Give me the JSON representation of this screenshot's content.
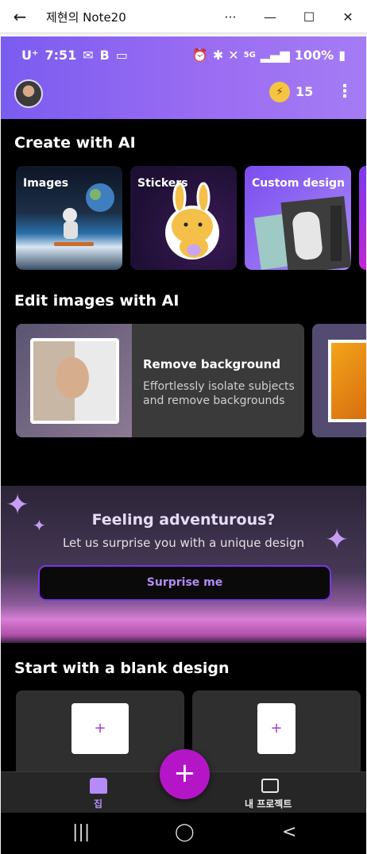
{
  "window": {
    "title": "제현의 Note20",
    "back_icon": "←",
    "more_icon": "···",
    "min_icon": "—",
    "max_icon": "☐",
    "close_icon": "✕"
  },
  "status_bar": {
    "carrier": "U⁺",
    "time": "7:51",
    "icons_left": [
      "mail-icon",
      "b-icon",
      "cast-icon"
    ],
    "icons_right": [
      "alarm-icon",
      "bluetooth-icon",
      "mute-icon",
      "5g-icon",
      "signal-icon",
      "battery-icon"
    ],
    "battery": "100%"
  },
  "header": {
    "coins": "15",
    "menu_icon": "⋮"
  },
  "create_section": {
    "title": "Create with AI",
    "cards": [
      {
        "label": "Images"
      },
      {
        "label": "Stickers"
      },
      {
        "label": "Custom design"
      }
    ]
  },
  "edit_section": {
    "title": "Edit images with AI",
    "card": {
      "title": "Remove background",
      "description": "Effortlessly isolate subjects and remove backgrounds"
    }
  },
  "promo": {
    "title": "Feeling adventurous?",
    "subtitle": "Let us surprise you with a unique design",
    "button_label": "Surprise me"
  },
  "blank_section": {
    "title": "Start with a blank design",
    "plus": "+"
  },
  "bottom_nav": {
    "home_label": "집",
    "projects_label": "내 프로젝트",
    "fab_icon": "+"
  },
  "system_nav": {
    "recents": "|||",
    "home": "◯",
    "back": "<"
  },
  "colors": {
    "accent": "#9a6cf2",
    "fab": "#b416c7",
    "button_border": "#7b35e6"
  }
}
